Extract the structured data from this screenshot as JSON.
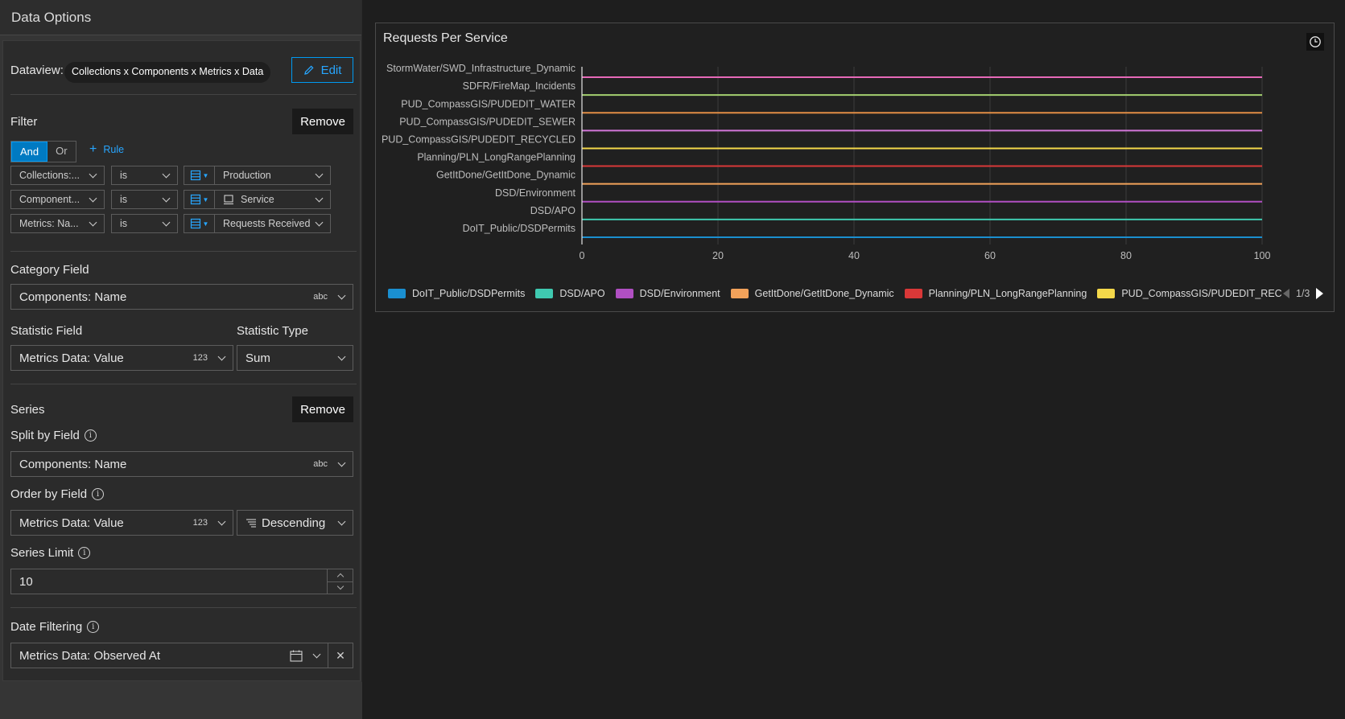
{
  "panel": {
    "title": "Data Options",
    "dataview": {
      "label": "Dataview:",
      "value": "Collections x Components x Metrics x Data",
      "edit_label": "Edit"
    },
    "filter": {
      "label": "Filter",
      "remove_label": "Remove",
      "and_label": "And",
      "or_label": "Or",
      "add_rule_label": "Rule",
      "rules": [
        {
          "field": "Collections:...",
          "operator": "is",
          "value": "Production"
        },
        {
          "field": "Component...",
          "operator": "is",
          "value": "Service"
        },
        {
          "field": "Metrics: Na...",
          "operator": "is",
          "value": "Requests Received"
        }
      ]
    },
    "category": {
      "label": "Category Field",
      "value": "Components: Name",
      "type_badge": "abc"
    },
    "statistic": {
      "field_label": "Statistic Field",
      "field_value": "Metrics Data: Value",
      "field_badge": "123",
      "type_label": "Statistic Type",
      "type_value": "Sum"
    },
    "series": {
      "label": "Series",
      "remove_label": "Remove",
      "split_label": "Split by Field",
      "split_value": "Components: Name",
      "split_badge": "abc",
      "order_label": "Order by Field",
      "order_value": "Metrics Data: Value",
      "order_badge": "123",
      "order_direction": "Descending",
      "limit_label": "Series Limit",
      "limit_value": "10"
    },
    "date_filtering": {
      "label": "Date Filtering",
      "value": "Metrics Data: Observed At"
    }
  },
  "chart": {
    "pager": "1/3"
  },
  "chart_data": {
    "type": "line",
    "title": "Requests Per Service",
    "orientation": "horizontal",
    "categories": [
      "StormWater/SWD_Infrastructure_Dynamic",
      "SDFR/FireMap_Incidents",
      "PUD_CompassGIS/PUDEDIT_WATER",
      "PUD_CompassGIS/PUDEDIT_SEWER",
      "PUD_CompassGIS/PUDEDIT_RECYCLED",
      "Planning/PLN_LongRangePlanning",
      "GetItDone/GetItDone_Dynamic",
      "DSD/Environment",
      "DSD/APO",
      "DoIT_Public/DSDPermits"
    ],
    "xlim": [
      0,
      100
    ],
    "x_ticks": [
      "0",
      "20",
      "40",
      "60",
      "80",
      "100"
    ],
    "grid": true,
    "legend_position": "bottom",
    "series": [
      {
        "name": "DoIT_Public/DSDPermits",
        "color": "#1a8fd0"
      },
      {
        "name": "DSD/APO",
        "color": "#3fc9b0"
      },
      {
        "name": "DSD/Environment",
        "color": "#b04fc2"
      },
      {
        "name": "GetItDone/GetItDone_Dynamic",
        "color": "#f2a25a"
      },
      {
        "name": "Planning/PLN_LongRangePlanning",
        "color": "#d93838"
      },
      {
        "name": "PUD_CompassGIS/PUDEDIT_RECYCLED",
        "color": "#f4d84a"
      },
      {
        "name": "PUD_CompassGIS/PUDEDIT_SEWER",
        "color": "#d277d9"
      },
      {
        "name": "PUD_CompassGIS/PUDEDIT_WATER",
        "color": "#e28e45"
      },
      {
        "name": "SDFR/FireMap_Incidents",
        "color": "#a4d06f"
      },
      {
        "name": "StormWater/SWD_Infrastructure_Dynamic",
        "color": "#e669b8"
      }
    ]
  }
}
